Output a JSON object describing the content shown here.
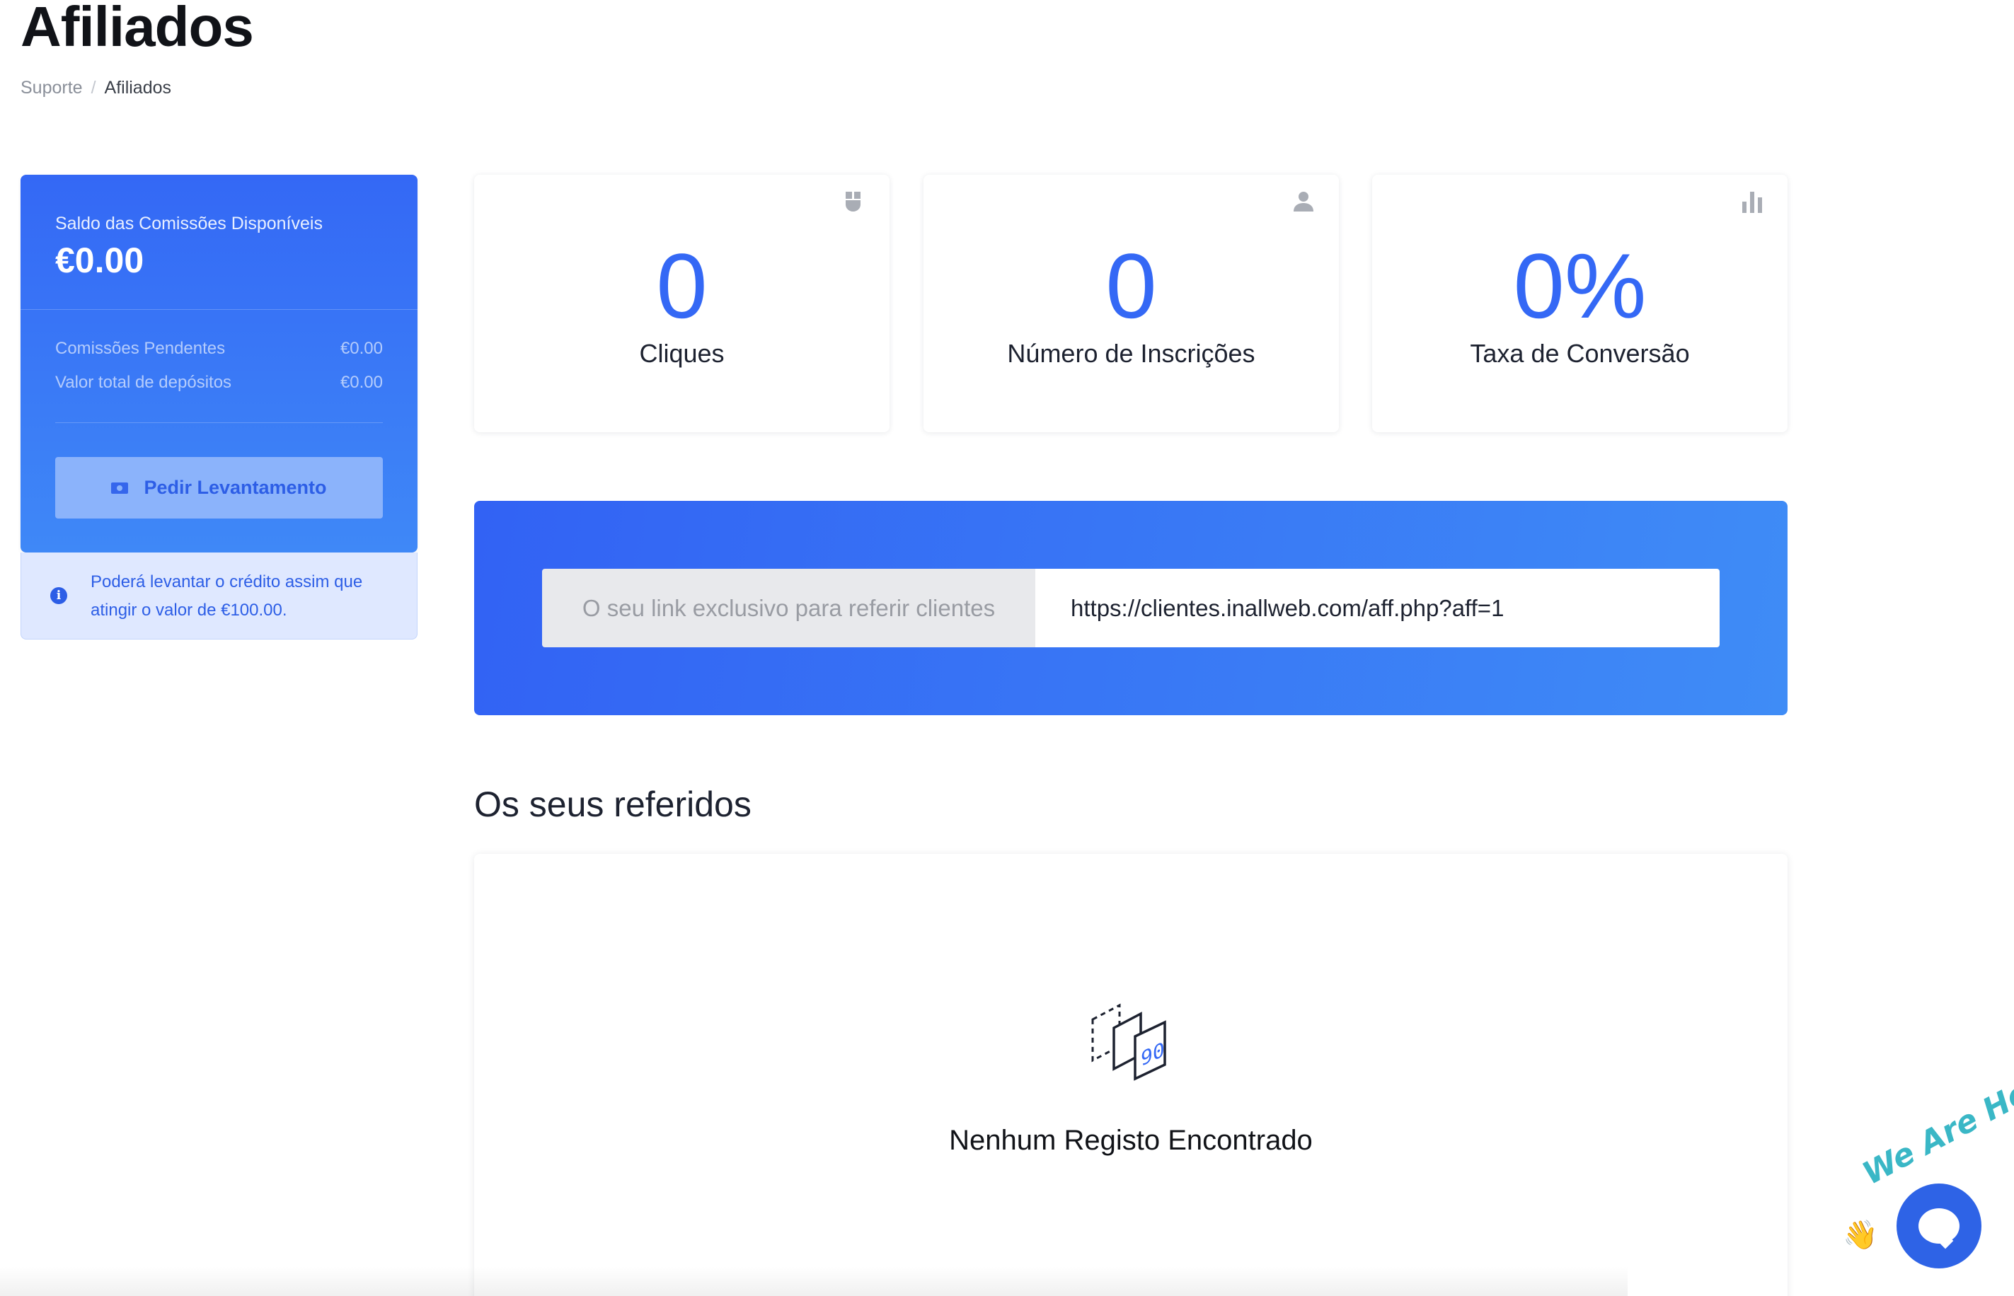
{
  "header": {
    "title": "Afiliados",
    "breadcrumb": [
      {
        "label": "Suporte"
      },
      {
        "label": "Afiliados"
      }
    ],
    "breadcrumb_separator": "/"
  },
  "balance": {
    "label": "Saldo das Comissões Disponíveis",
    "amount": "€0.00",
    "rows": [
      {
        "label": "Comissões Pendentes",
        "value": "€0.00"
      },
      {
        "label": "Valor total de depósitos",
        "value": "€0.00"
      }
    ],
    "withdraw_button": "Pedir Levantamento",
    "note": "Poderá levantar o crédito assim que atingir o valor de €100.00."
  },
  "stats": [
    {
      "icon": "mouse-icon",
      "value": "0",
      "label": "Cliques"
    },
    {
      "icon": "user-icon",
      "value": "0",
      "label": "Número de Inscrições"
    },
    {
      "icon": "bar-chart-icon",
      "value": "0%",
      "label": "Taxa de Conversão"
    }
  ],
  "referral": {
    "prefix": "O seu link exclusivo para referir clientes",
    "link": "https://clientes.inallweb.com/aff.php?aff=1"
  },
  "referrals_section": {
    "title": "Os seus referidos",
    "empty_message": "Nenhum Registo Encontrado"
  },
  "chat_widget": {
    "badge": "We Are Here!",
    "wave": "👋"
  },
  "colors": {
    "accent": "#3468f5",
    "note_bg": "#dfe8ff",
    "chat": "#2e63e6"
  }
}
